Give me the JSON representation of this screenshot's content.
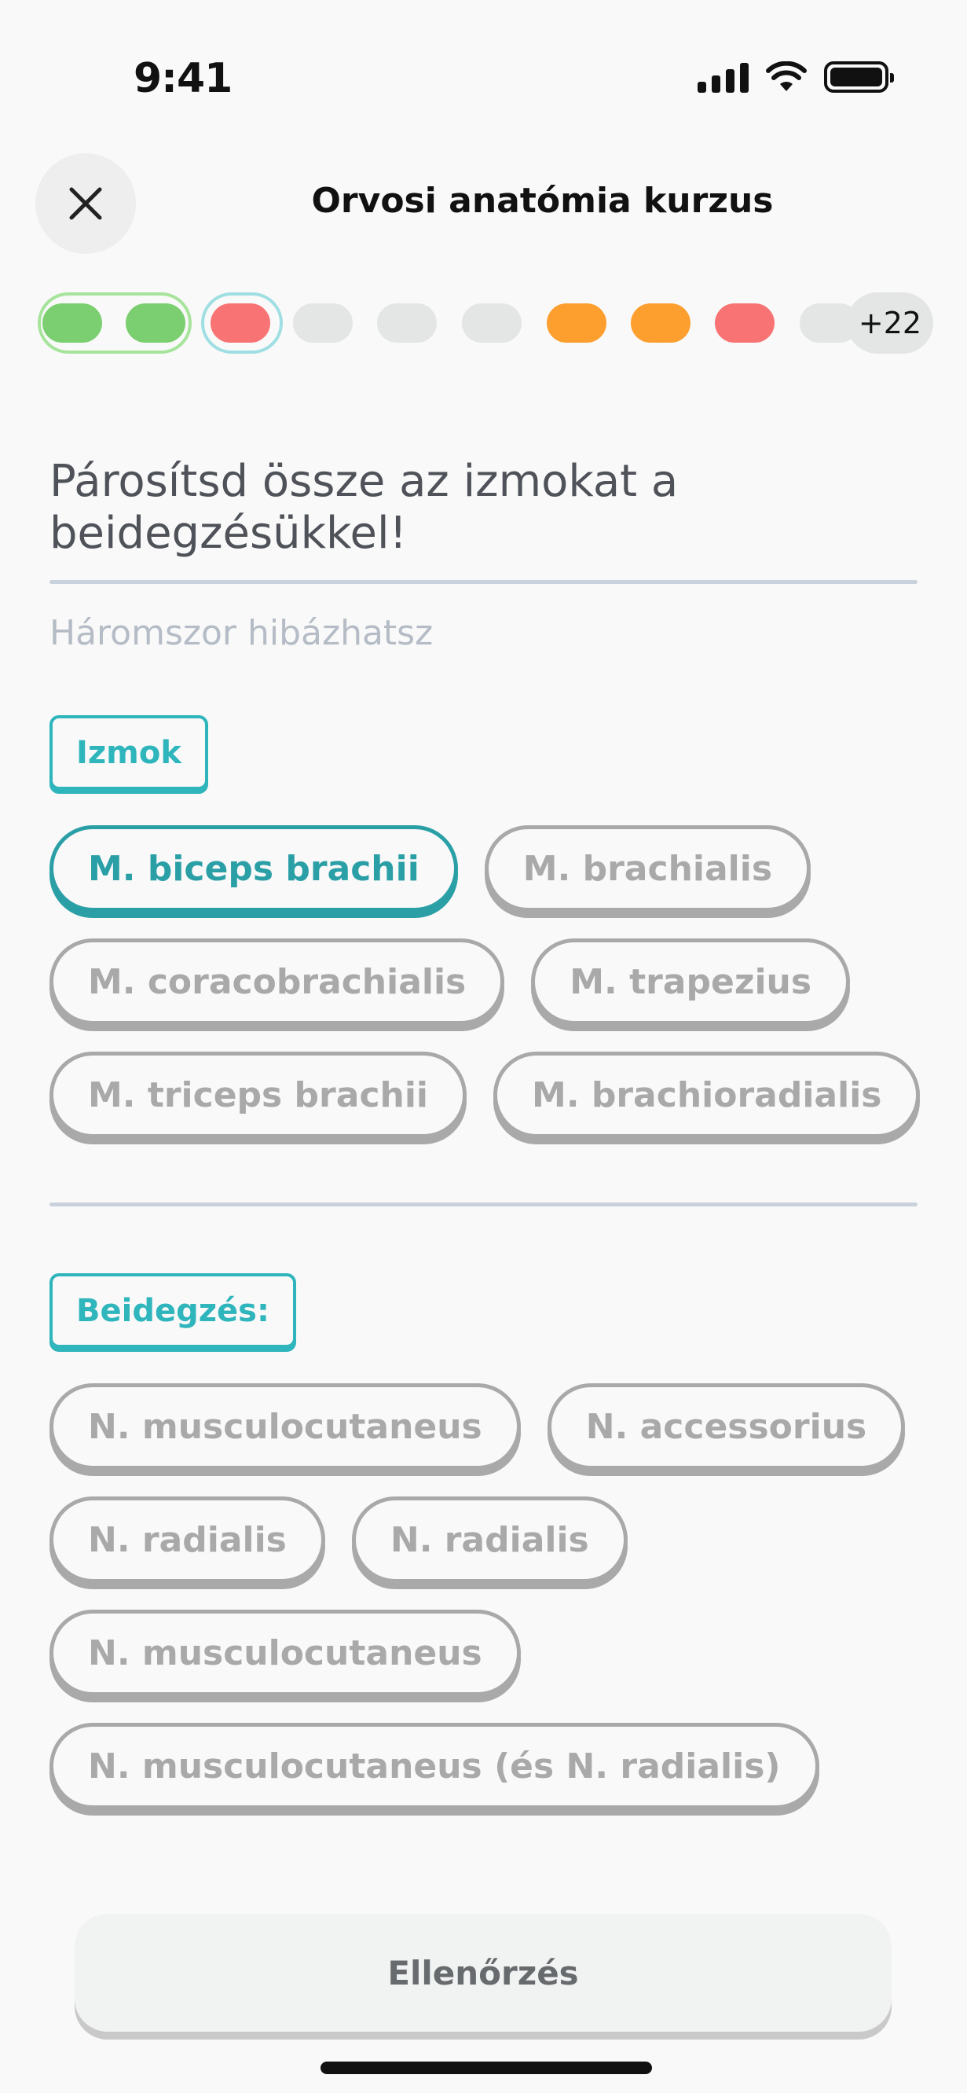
{
  "status": {
    "time": "9:41"
  },
  "header": {
    "title": "Orvosi anatómia kurzus"
  },
  "progress": {
    "segments": [
      "correct",
      "correct",
      "wrong",
      "pending",
      "pending",
      "pending",
      "partial",
      "partial",
      "wrong",
      "pending"
    ],
    "more_label": "+22",
    "colors": {
      "correct": "#7ccf70",
      "wrong": "#f77374",
      "partial": "#fd9f2f",
      "pending": "#e4e5e5"
    }
  },
  "question": {
    "prompt": "Párosítsd össze az izmokat a beidegzésükkel!",
    "hint": "Háromszor hibázhatsz"
  },
  "muscles": {
    "label": "Izmok",
    "items": [
      {
        "label": "M. biceps brachii",
        "selected": true
      },
      {
        "label": "M. brachialis",
        "selected": false
      },
      {
        "label": "M. coracobrachialis",
        "selected": false
      },
      {
        "label": "M. trapezius",
        "selected": false
      },
      {
        "label": "M. triceps brachii",
        "selected": false
      },
      {
        "label": "M. brachioradialis",
        "selected": false
      }
    ]
  },
  "innervation": {
    "label": "Beidegzés:",
    "items": [
      {
        "label": "N. musculocutaneus"
      },
      {
        "label": "N. accessorius"
      },
      {
        "label": "N. radialis"
      },
      {
        "label": "N. radialis"
      },
      {
        "label": "N. musculocutaneus"
      },
      {
        "label": "N. musculocutaneus (és N. radialis)"
      }
    ]
  },
  "footer": {
    "check_label": "Ellenőrzés"
  },
  "theme": {
    "accent": "#2fb5bc",
    "accent_dark": "#2a9fa6",
    "chip_gray": "#a9a9a9"
  }
}
